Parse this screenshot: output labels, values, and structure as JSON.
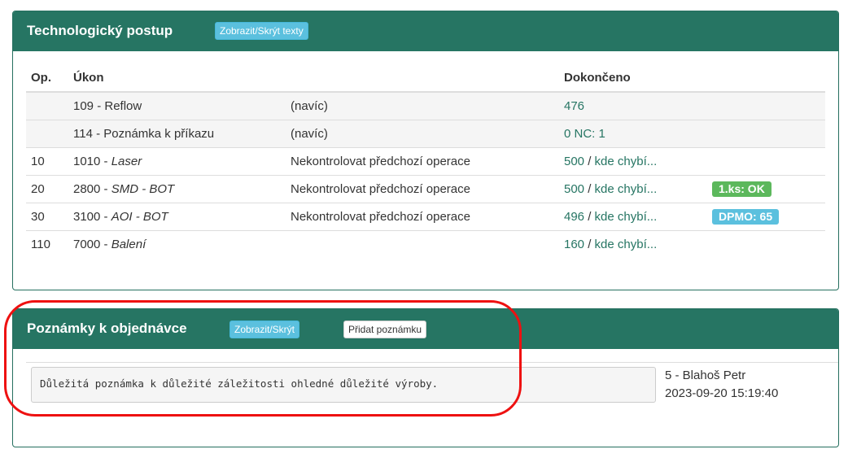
{
  "tech": {
    "title": "Technologický postup",
    "toggle_button": "Zobrazit/Skrýt texty",
    "headers": {
      "op": "Op.",
      "ukon": "Úkon",
      "note": "",
      "done": "Dokončeno",
      "status": ""
    },
    "rows": [
      {
        "op": "",
        "code": "109 - ",
        "name": "Reflow",
        "italic": false,
        "note": "(navíc)",
        "done": "476",
        "missing": "",
        "badge": "",
        "badge_type": "",
        "extra": true
      },
      {
        "op": "",
        "code": "114 - ",
        "name": "Poznámka k příkazu",
        "italic": false,
        "note": "(navíc)",
        "done": "0 NC: 1",
        "missing": "",
        "badge": "",
        "badge_type": "",
        "extra": true
      },
      {
        "op": "10",
        "code": "1010 - ",
        "name": "Laser",
        "italic": true,
        "note": "Nekontrolovat předchozí operace",
        "done": "500",
        "missing": "kde chybí...",
        "badge": "",
        "badge_type": "",
        "extra": false
      },
      {
        "op": "20",
        "code": "2800 - ",
        "name": "SMD - BOT",
        "italic": true,
        "note": "Nekontrolovat předchozí operace",
        "done": "500",
        "missing": "kde chybí...",
        "badge": "1.ks: OK",
        "badge_type": "success",
        "extra": false
      },
      {
        "op": "30",
        "code": "3100 - ",
        "name": "AOI - BOT",
        "italic": true,
        "note": "Nekontrolovat předchozí operace",
        "done": "496",
        "missing": "kde chybí...",
        "badge": "DPMO: 65",
        "badge_type": "info",
        "extra": false
      },
      {
        "op": "110",
        "code": "7000 - ",
        "name": "Balení",
        "italic": true,
        "note": "",
        "done": "160",
        "missing": "kde chybí...",
        "badge": "",
        "badge_type": "",
        "extra": false
      }
    ],
    "separator": " / "
  },
  "notes": {
    "title": "Poznámky k objednávce",
    "toggle_button": "Zobrazit/Skrýt",
    "add_button": "Přidat poznámku",
    "items": [
      {
        "text": "Důležitá poznámka k důležité záležitosti ohledné důležité výroby.",
        "author": "5 - Blahoš Petr",
        "timestamp": "2023-09-20 15:19:40"
      }
    ]
  },
  "colors": {
    "header_green": "#267563",
    "link_green": "#267563",
    "info_blue": "#5bc0de",
    "success_green": "#5cb85c",
    "highlight_red": "#ee1111"
  }
}
